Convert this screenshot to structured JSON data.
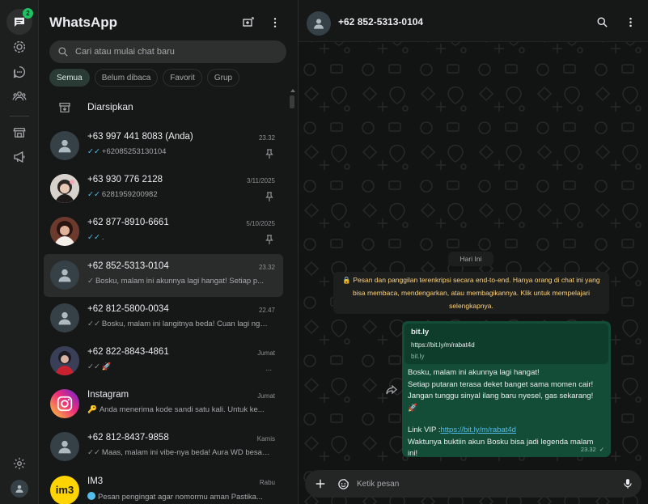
{
  "rail": {
    "unread_count": "2"
  },
  "list": {
    "title": "WhatsApp",
    "search_placeholder": "Cari atau mulai chat baru",
    "filters": [
      "Semua",
      "Belum dibaca",
      "Favorit",
      "Grup"
    ],
    "archived_label": "Diarsipkan"
  },
  "chats": [
    {
      "name": "+63 997 441 8083 (Anda)",
      "time": "23.32",
      "preview": "+62085253130104",
      "tick": "✓✓",
      "pinned": true
    },
    {
      "name": "+63 930 776 2128",
      "time": "3/11/2025",
      "preview": "6281959200982",
      "tick": "✓✓",
      "pinned": true
    },
    {
      "name": "+62 877-8910-6661",
      "time": "5/10/2025",
      "preview": ".",
      "tick": "✓✓",
      "pinned": true
    },
    {
      "name": "+62 852-5313-0104",
      "time": "23.32",
      "preview": "Bosku, malam ini akunnya lagi hangat! Setiap p...",
      "tick": "✓"
    },
    {
      "name": "+62 812-5800-0034",
      "time": "22.47",
      "preview": "Bosku, malam ini langitnya beda! Cuan lagi ngu...",
      "tick": "✓✓"
    },
    {
      "name": "+62 822-8843-4861",
      "time": "Jumat",
      "preview": "🚀",
      "tick": "✓✓",
      "more": "..."
    },
    {
      "name": "Instagram",
      "time": "Jumat",
      "preview": "Anda menerima kode sandi satu kali. Untuk ke...",
      "key": "🔑"
    },
    {
      "name": "+62 812-8437-9858",
      "time": "Kamis",
      "preview": "Maas, malam ini vibe-nya beda! Aura WD besar ...",
      "tick": "✓✓"
    },
    {
      "name": "IM3",
      "time": "Rabu",
      "preview": "Pesan pengingat agar nomormu aman Pastika...",
      "avatar_text": "im3"
    }
  ],
  "conversation": {
    "contact": "+62 852-5313-0104",
    "day_label": "Hari Ini",
    "e2e_notice": "🔒 Pesan dan panggilan terenkripsi secara end-to-end. Hanya orang di chat ini yang bisa membaca, mendengarkan, atau membagikannya. Klik untuk mempelajari selengkapnya.",
    "link_preview": {
      "title": "bit.ly",
      "url": "https://bit.ly/m/rabat4d",
      "domain": "bit.ly"
    },
    "message": {
      "line1": "Bosku, malam ini akunnya lagi hangat!",
      "line2": "Setiap putaran terasa deket banget sama momen cair!",
      "line3": "Jangan tunggu sinyal ilang baru nyesel, gas sekarang!",
      "line4": "🚀",
      "link_label": "Link VIP :",
      "link": "https://bit.ly/m/rabat4d",
      "line5": "Waktunya buktiin akun Bosku bisa jadi legenda malam ini!",
      "time": "23.32",
      "status": "✓"
    },
    "composer_placeholder": "Ketik pesan"
  },
  "colors": {
    "accent": "#21c063",
    "bubble_out": "#144d37",
    "link": "#53bdeb",
    "notice": "#ffd279"
  }
}
